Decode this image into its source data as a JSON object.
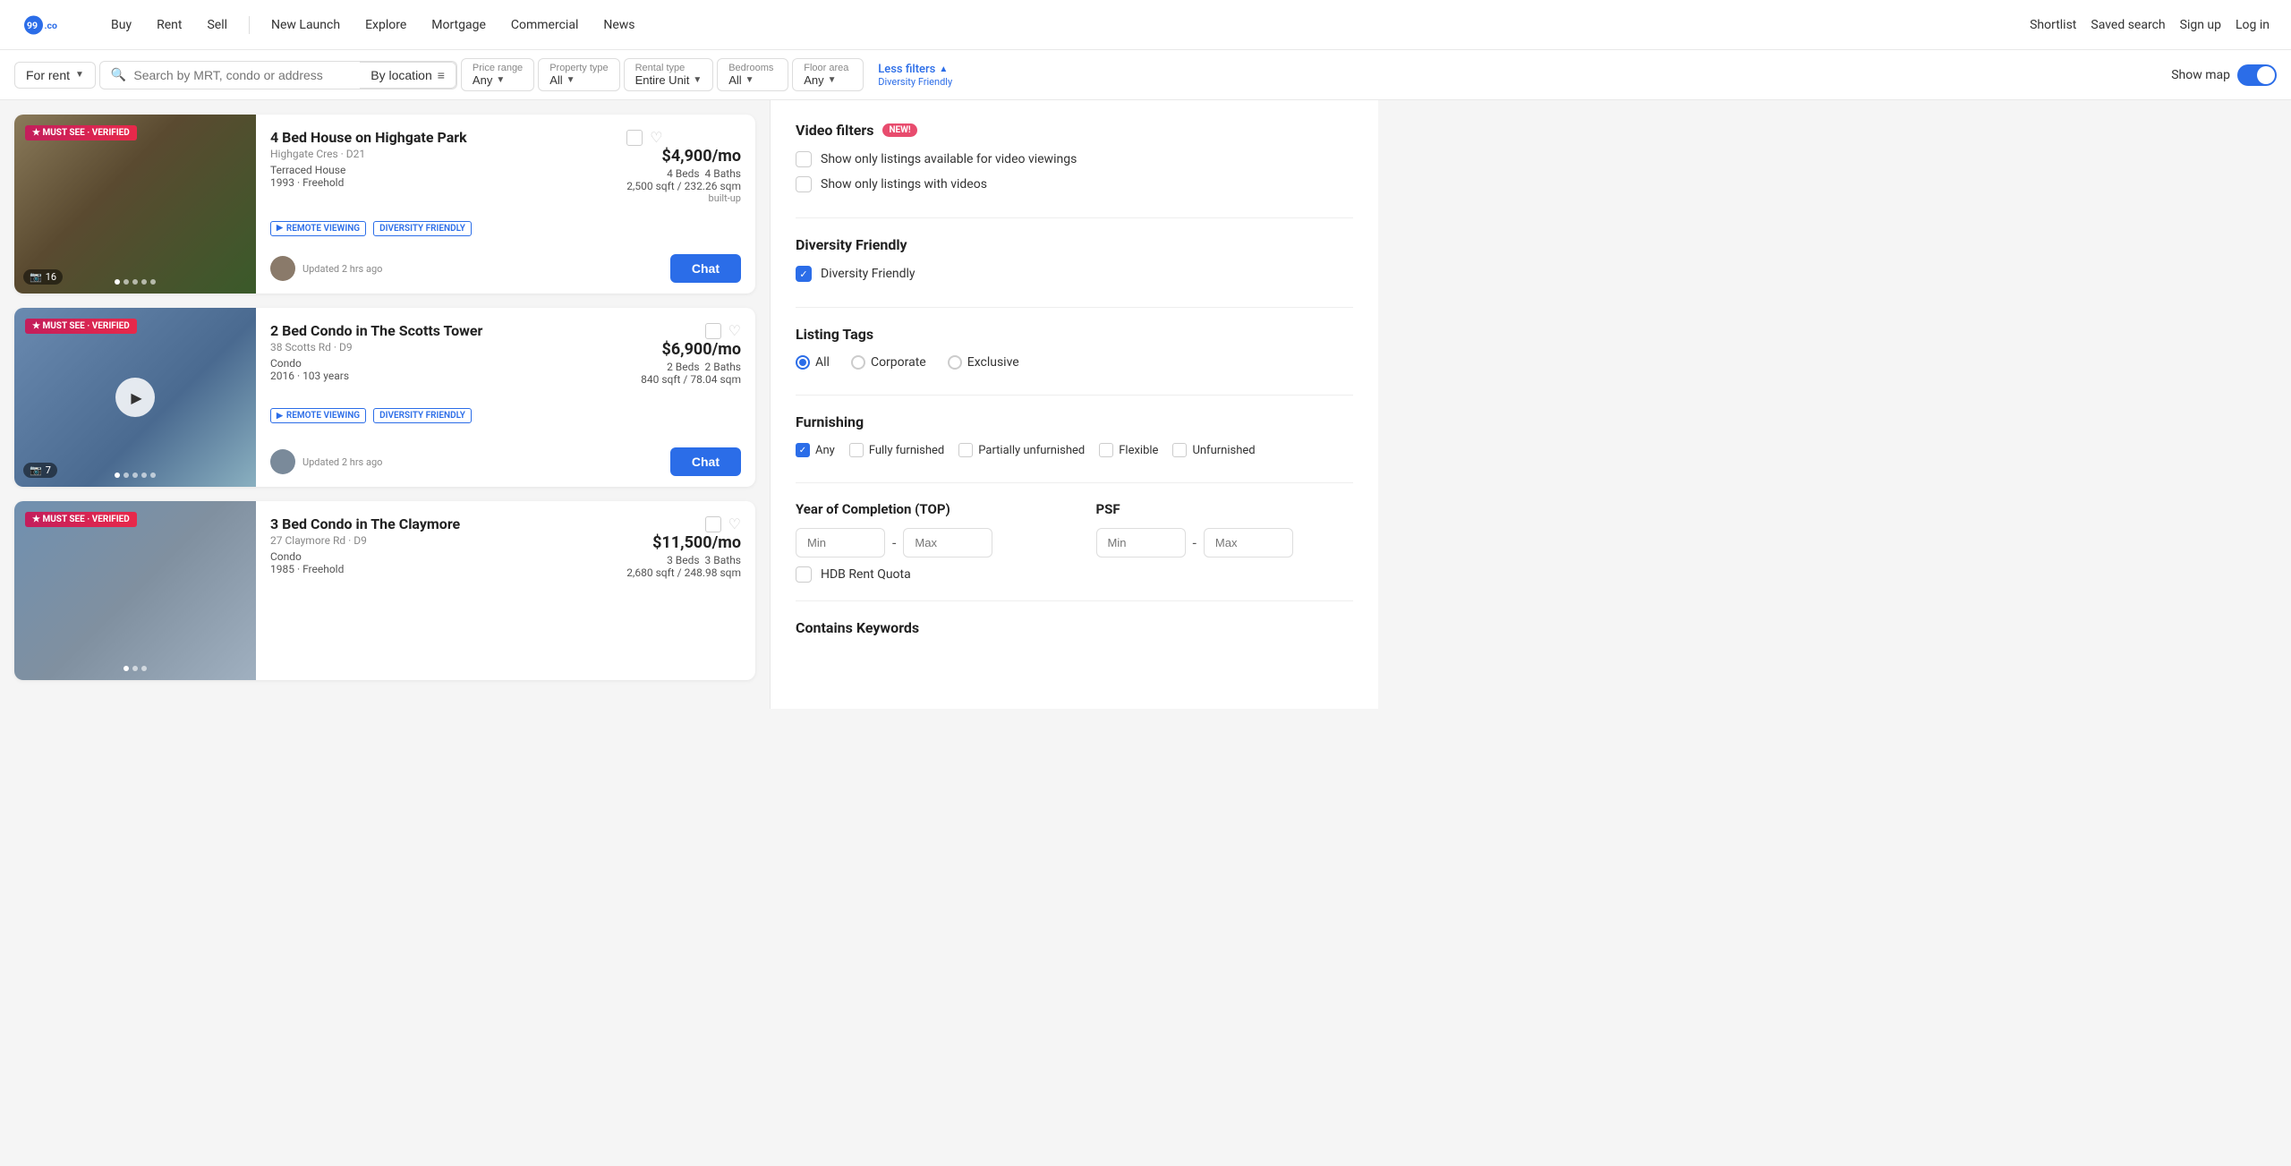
{
  "navbar": {
    "logo_text": "99.co",
    "links": [
      "Buy",
      "Rent",
      "Sell",
      "New Launch",
      "Explore",
      "Mortgage",
      "Commercial",
      "News"
    ],
    "right_links": [
      "Shortlist",
      "Saved search",
      "Sign up",
      "Log in"
    ]
  },
  "filter_bar": {
    "for_rent_label": "For rent",
    "search_placeholder": "Search by MRT, condo or address",
    "by_location_label": "By location",
    "filters": [
      {
        "label": "Price range",
        "value": "Any"
      },
      {
        "label": "Property type",
        "value": "All"
      },
      {
        "label": "Rental type",
        "value": "Entire Unit"
      },
      {
        "label": "Bedrooms",
        "value": "All"
      },
      {
        "label": "Floor area",
        "value": "Any"
      }
    ],
    "less_filters_label": "Less filters",
    "less_filters_sub": "Diversity Friendly",
    "show_map_label": "Show map"
  },
  "listings": [
    {
      "badge": "★ MUST SEE · VERIFIED",
      "title": "4 Bed House on Highgate Park",
      "address": "Highgate Cres · D21",
      "property_type": "Terraced House",
      "year_tenure": "1993 · Freehold",
      "price": "$4,900/mo",
      "beds": "4 Beds",
      "baths": "4 Baths",
      "sqft": "2,500 sqft / 232.26 sqm",
      "sqft_label": "built-up",
      "tags": [
        "REMOTE VIEWING",
        "DIVERSITY FRIENDLY"
      ],
      "updated": "Updated 2 hrs ago",
      "photo_count": "16",
      "img_class": "listing-img-1",
      "chat_label": "Chat"
    },
    {
      "badge": "★ MUST SEE · VERIFIED",
      "title": "2 Bed Condo in The Scotts Tower",
      "address": "38 Scotts Rd · D9",
      "property_type": "Condo",
      "year_tenure": "2016 · 103 years",
      "price": "$6,900/mo",
      "beds": "2 Beds",
      "baths": "2 Baths",
      "sqft": "840 sqft / 78.04 sqm",
      "sqft_label": "",
      "tags": [
        "REMOTE VIEWING",
        "DIVERSITY FRIENDLY"
      ],
      "updated": "Updated 2 hrs ago",
      "photo_count": "7",
      "img_class": "listing-img-2",
      "has_video": true,
      "chat_label": "Chat"
    },
    {
      "badge": "★ MUST SEE · VERIFIED",
      "title": "3 Bed Condo in The Claymore",
      "address": "27 Claymore Rd · D9",
      "property_type": "Condo",
      "year_tenure": "1985 · Freehold",
      "price": "$11,500/mo",
      "beds": "3 Beds",
      "baths": "3 Baths",
      "sqft": "2,680 sqft / 248.98 sqm",
      "sqft_label": "",
      "tags": [],
      "updated": "",
      "photo_count": "",
      "img_class": "listing-img-3",
      "chat_label": "Chat"
    }
  ],
  "filters_panel": {
    "video_filters_title": "Video filters",
    "new_badge": "NEW!",
    "video_option1": "Show only listings available for video viewings",
    "video_option2": "Show only listings with videos",
    "diversity_section_title": "Diversity Friendly",
    "diversity_option": "Diversity Friendly",
    "listing_tags_title": "Listing Tags",
    "listing_tags_options": [
      "All",
      "Corporate",
      "Exclusive"
    ],
    "listing_tags_selected": "All",
    "furnishing_title": "Furnishing",
    "furnishing_options": [
      "Any",
      "Fully furnished",
      "Partially unfurnished",
      "Flexible",
      "Unfurnished"
    ],
    "top_section_title": "Year of Completion (TOP)",
    "psf_section_title": "PSF",
    "top_min_placeholder": "Min",
    "top_max_placeholder": "Max",
    "psf_min_placeholder": "Min",
    "psf_max_placeholder": "Max",
    "hdb_rent_quota": "HDB Rent Quota",
    "contains_keywords_title": "Contains Keywords"
  }
}
